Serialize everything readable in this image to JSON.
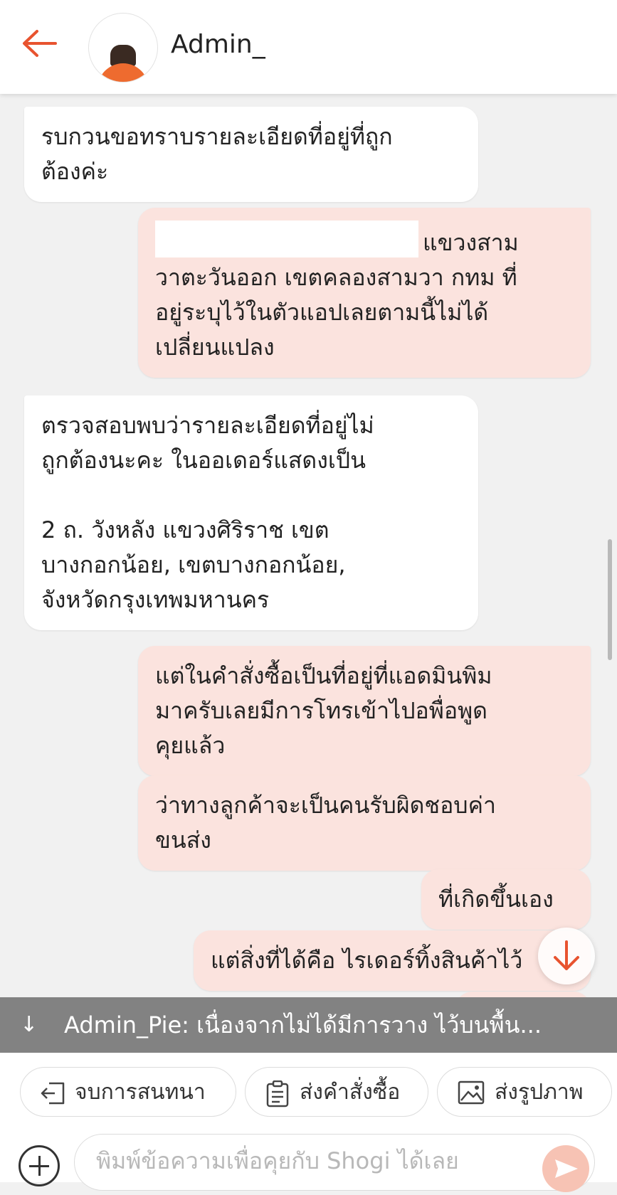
{
  "header": {
    "title": "Admin_"
  },
  "messages": [
    {
      "dir": "in",
      "lines": [
        "รบกวนขอทราบรายละเอียดที่อยู่ที่ถูก",
        "ต้องค่ะ"
      ]
    },
    {
      "dir": "out",
      "lines": [
        "แขวงสาม",
        "วาตะวันออก เขตคลองสามวา กทม ที่",
        "อยู่ระบุไว้ในตัวแอปเลยตามนี้ไม่ได้",
        "เปลี่ยนแปลง"
      ]
    },
    {
      "dir": "in",
      "lines": [
        "ตรวจสอบพบว่ารายละเอียดที่อยู่ไม่",
        "ถูกต้องนะคะ ในออเดอร์แสดงเป็น",
        "",
        "2 ถ. วังหลัง แขวงศิริราช เขต",
        "บางกอกน้อย, เขตบางกอกน้อย,",
        "จังหวัดกรุงเทพมหานคร"
      ]
    },
    {
      "dir": "out",
      "lines": [
        "แต่ในคำสั่งซื้อเป็นที่อยู่ที่แอดมินพิม",
        "มาครับเลยมีการโทรเข้าไปอพื่อพูด",
        "คุยแล้ว"
      ]
    },
    {
      "dir": "out",
      "lines": [
        "ว่าทางลูกค้าจะเป็นคนรับผิดชอบค่า",
        "ขนส่ง"
      ]
    },
    {
      "dir": "out",
      "lines": [
        "ที่เกิดขึ้นเอง"
      ]
    },
    {
      "dir": "out",
      "lines": [
        "แต่สิ่งที่ได้คือ ไรเดอร์ทิ้งสินค้าไว้"
      ]
    }
  ],
  "new_message_banner": {
    "text": "Admin_Pie: เนื่องจากไม่ได้มีการวาง ไว้บนพื้น..."
  },
  "quick_actions": [
    {
      "label": "จบการสนทนา",
      "icon": "exit-icon"
    },
    {
      "label": "ส่งคำสั่งซื้อ",
      "icon": "clipboard-icon"
    },
    {
      "label": "ส่งรูปภาพ",
      "icon": "image-icon"
    }
  ],
  "composer": {
    "placeholder": "พิมพ์ข้อความเพื่อคุยกับ Shogi ได้เลย"
  },
  "colors": {
    "accent": "#e8532f",
    "outgoing_bubble": "#fbe3de",
    "incoming_bubble": "#ffffff",
    "background": "#f1f1f1"
  }
}
